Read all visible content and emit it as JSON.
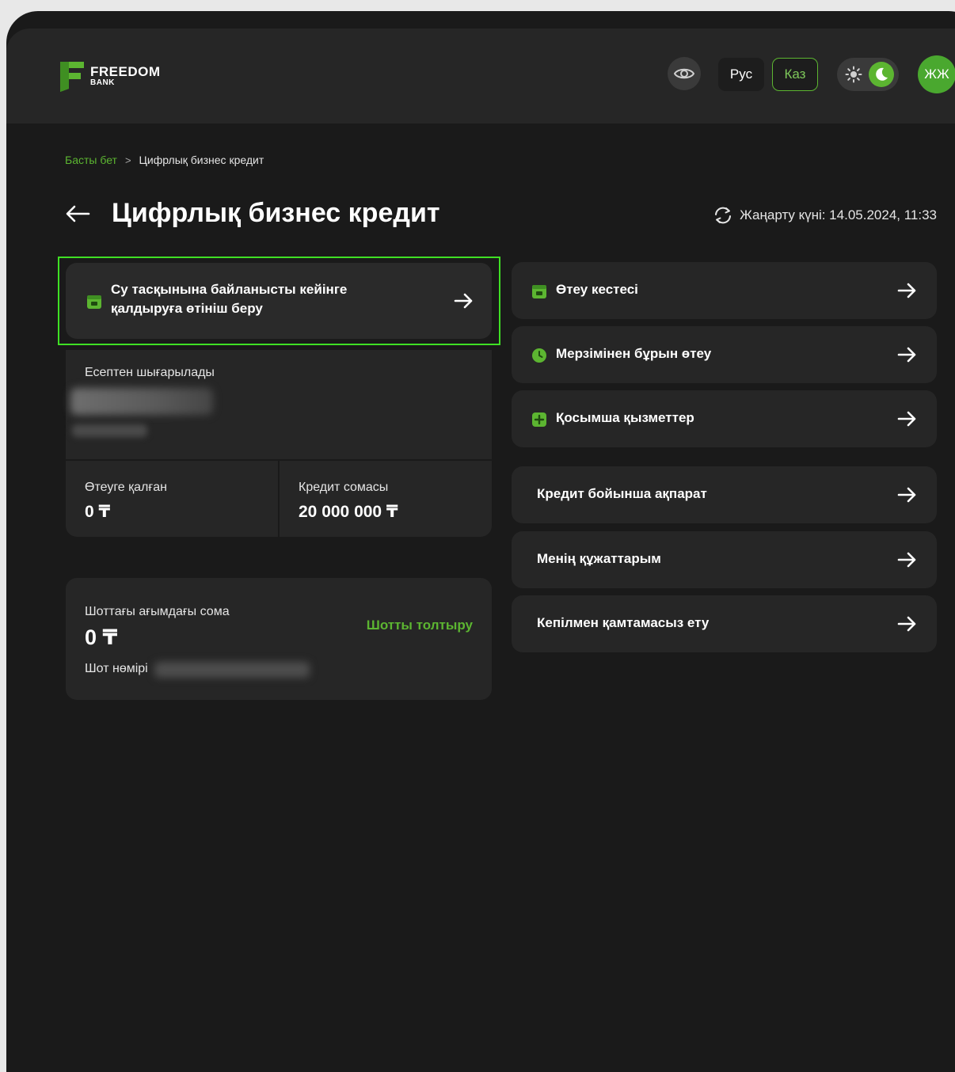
{
  "header": {
    "logo_line1": "FREEDOM",
    "logo_line2": "BANK",
    "lang_ru": "Рус",
    "lang_kz": "Каз",
    "avatar_initials": "ЖЖ"
  },
  "breadcrumb": {
    "home": "Басты бет",
    "separator": ">",
    "current": "Цифрлық бизнес кредит"
  },
  "page": {
    "title": "Цифрлық бизнес кредит",
    "update_text": "Жаңарту күні: 14.05.2024, 11:33"
  },
  "deferral_card": {
    "text": "Су тасқынына байланысты кейінге қалдыруға өтініш беру"
  },
  "loan_card": {
    "writeoff_label": "Есептен шығарылады",
    "remaining_label": "Өтеуге қалған",
    "remaining_value": "0 ₸",
    "amount_label": "Кредит сомасы",
    "amount_value": "20 000 000 ₸"
  },
  "account_card": {
    "balance_label": "Шоттағы ағымдағы сома",
    "balance_value": "0 ₸",
    "topup_link": "Шотты толтыру",
    "number_label": "Шот нөмірі"
  },
  "actions": [
    {
      "label": "Өтеу кестесі",
      "icon": "calendar-icon"
    },
    {
      "label": "Мерзімінен бұрын өтеу",
      "icon": "clock-icon"
    },
    {
      "label": "Қосымша қызметтер",
      "icon": "plus-square-icon"
    },
    {
      "label": "Кредит бойынша ақпарат",
      "icon": ""
    },
    {
      "label": "Менің құжаттарым",
      "icon": ""
    },
    {
      "label": "Кепілмен қамтамасыз ету",
      "icon": ""
    }
  ],
  "colors": {
    "accent": "#5cb531",
    "highlight_border": "#3fe024",
    "background": "#1a1a1a",
    "card": "#262626"
  }
}
